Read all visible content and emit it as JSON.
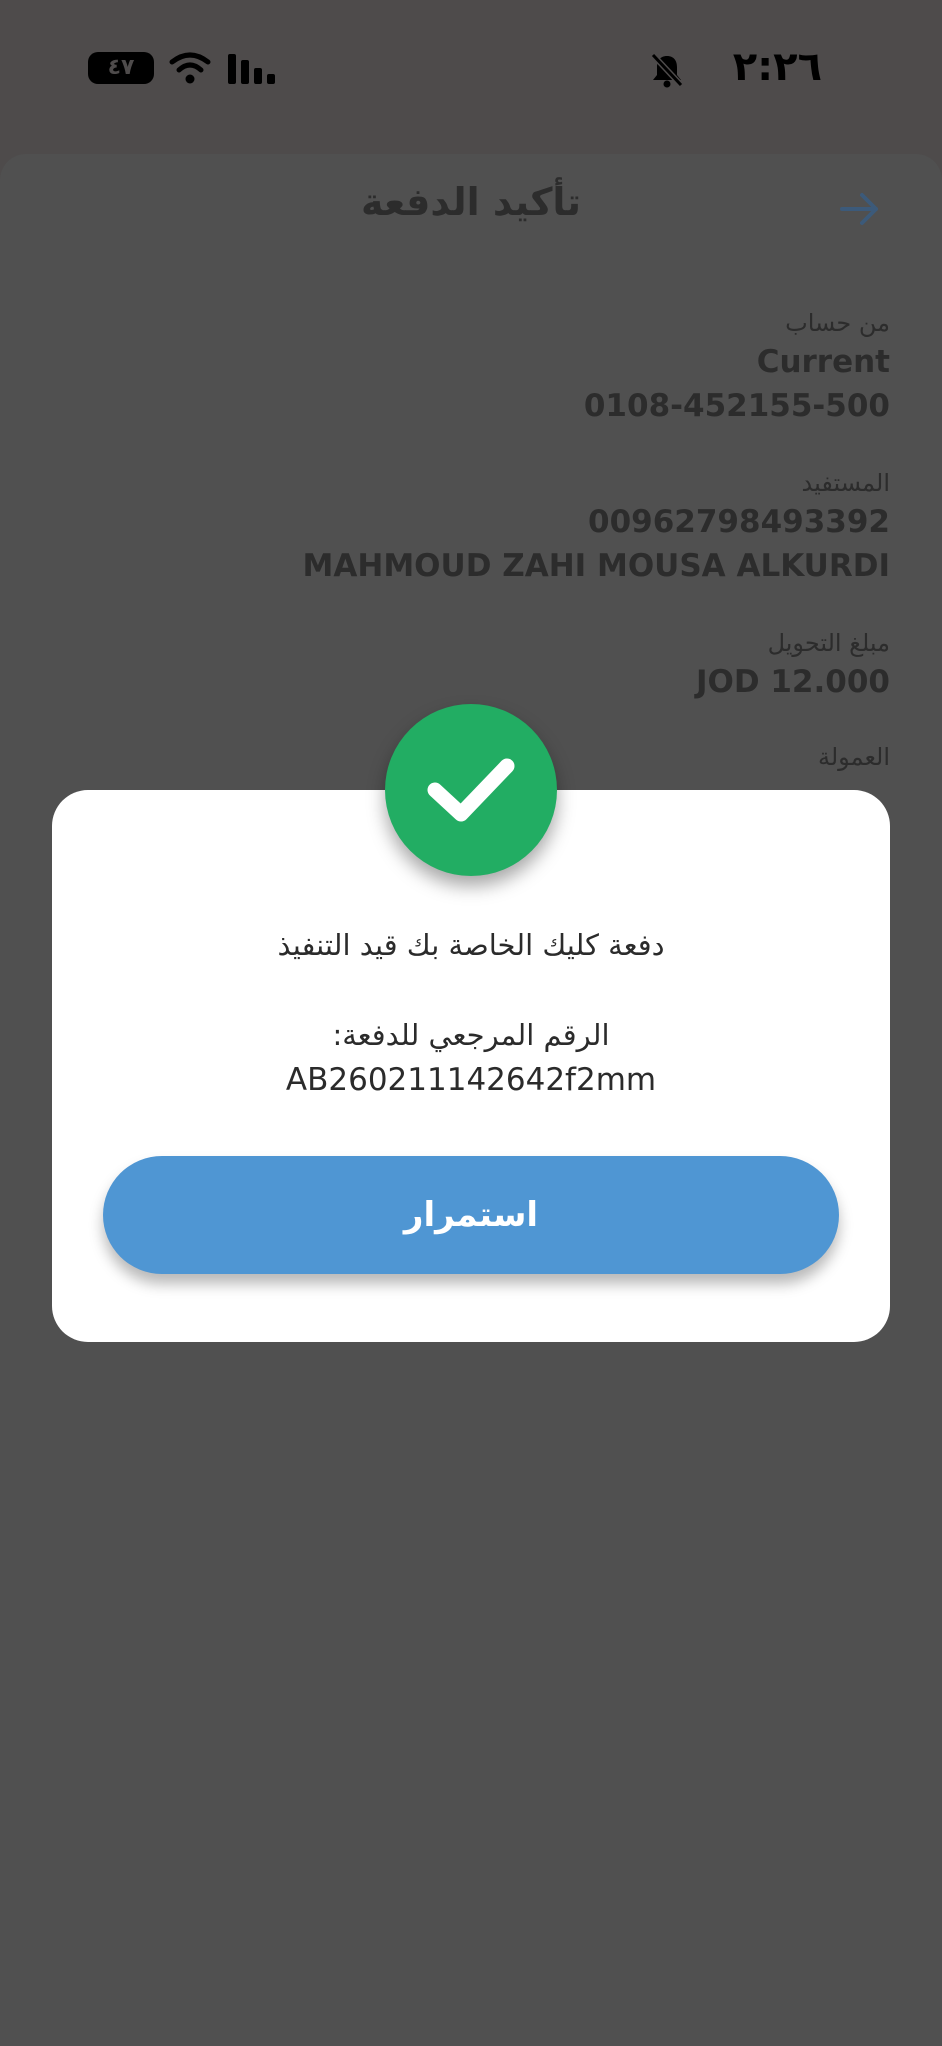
{
  "status_bar": {
    "time": "٢:٢٦",
    "battery": "٤٧"
  },
  "screen": {
    "title": "تأكيد الدفعة",
    "details": [
      {
        "label": "من حساب",
        "values": [
          "Current",
          "0108-452155-500"
        ]
      },
      {
        "label": "المستفيد",
        "values": [
          "00962798493392",
          "MAHMOUD ZAHI MOUSA ALKURDI"
        ]
      },
      {
        "label": "مبلغ التحويل",
        "values": [
          "JOD 12.000"
        ]
      },
      {
        "label": "العمولة",
        "values": []
      }
    ]
  },
  "dialog": {
    "message": "دفعة كليك الخاصة بك قيد التنفيذ",
    "reference_label": "الرقم المرجعي للدفعة:",
    "reference_value": "AB260211142642f2mm",
    "continue_label": "استمرار"
  },
  "colors": {
    "success": "#22ad63",
    "primary_button": "#4f96d3",
    "overlay": "#4e4b4b"
  }
}
